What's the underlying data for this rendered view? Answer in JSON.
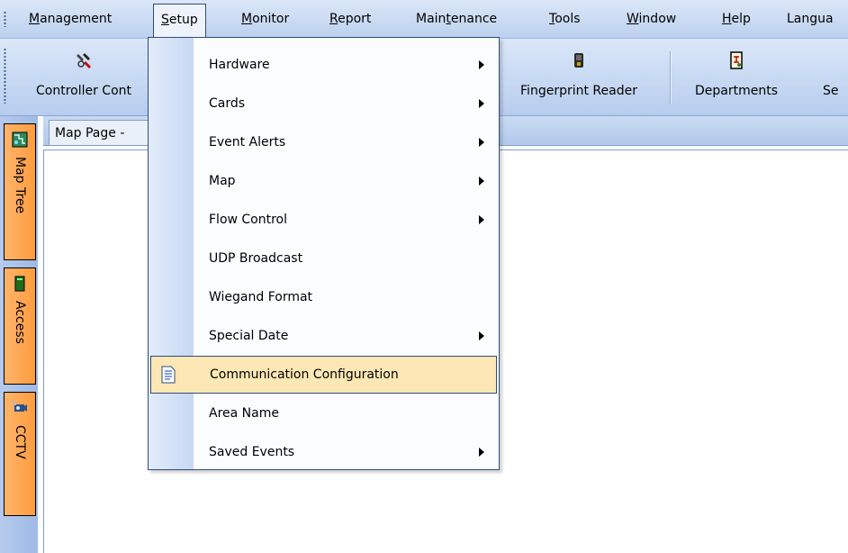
{
  "menubar": {
    "items": [
      {
        "label": "Management",
        "underline": 0
      },
      {
        "label": "Setup",
        "underline": 0
      },
      {
        "label": "Monitor",
        "underline": 0
      },
      {
        "label": "Report",
        "underline": 0
      },
      {
        "label": "Maintenance",
        "underline": 4
      },
      {
        "label": "Tools",
        "underline": 0
      },
      {
        "label": "Window",
        "underline": 0
      },
      {
        "label": "Help",
        "underline": 0
      },
      {
        "label": "Langua",
        "underline": -1
      }
    ]
  },
  "toolbar": {
    "controller_label": "Controller Cont",
    "fingerprint_label": "Fingerprint Reader",
    "departments_label": "Departments",
    "se_label": "Se"
  },
  "dock": {
    "tabs": [
      {
        "label": "Map Tree"
      },
      {
        "label": "Access"
      },
      {
        "label": "CCTV"
      }
    ]
  },
  "document": {
    "tab_title": "Map Page -"
  },
  "setup_menu": {
    "items": [
      {
        "label": "Hardware",
        "submenu": true
      },
      {
        "label": "Cards",
        "submenu": true
      },
      {
        "label": "Event Alerts",
        "submenu": true
      },
      {
        "label": "Map",
        "submenu": true
      },
      {
        "label": "Flow Control",
        "submenu": true
      },
      {
        "label": "UDP Broadcast",
        "submenu": false
      },
      {
        "label": "Wiegand Format",
        "submenu": false
      },
      {
        "label": "Special Date",
        "submenu": true
      },
      {
        "label": "Communication Configuration",
        "submenu": false,
        "highlighted": true,
        "icon": "document-icon"
      },
      {
        "label": "Area Name",
        "submenu": false
      },
      {
        "label": "Saved Events",
        "submenu": true
      }
    ]
  },
  "colors": {
    "highlight": "#fde7b4",
    "dock_tab": "#ff9c3e",
    "menu_border": "#2e4d7b"
  }
}
